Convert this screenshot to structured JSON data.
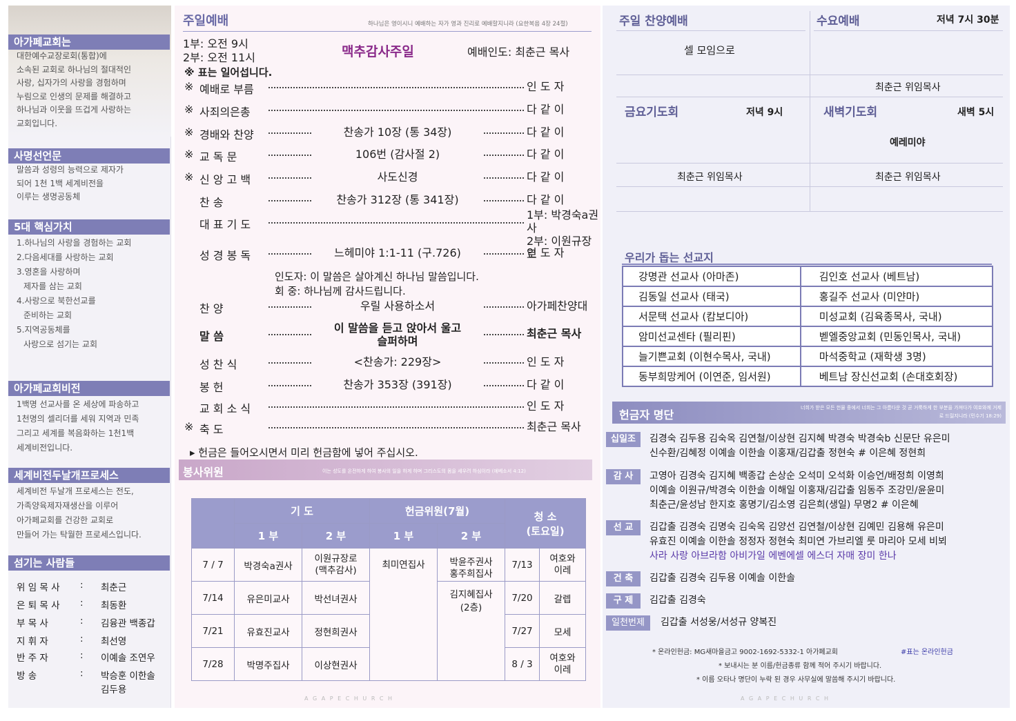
{
  "left": {
    "agape_title": "아가페교회는",
    "agape_body": [
      "대한예수교장로회(통합)에",
      "소속된 교회로 하나님의 절대적인",
      "사랑, 십자가의 사랑을 경험하며",
      "누림으로 인생의 문제를 해결하고",
      "하나님과 이웃을 뜨겁게 사랑하는",
      "교회입니다."
    ],
    "mission_title": "사명선언문",
    "mission_body": [
      "말씀과 성령의 능력으로 제자가",
      "되어 1천 1백 세계비전을",
      "이루는 생명공동체"
    ],
    "core_title": "5대 핵심가치",
    "core_body": [
      "1.하나님의 사랑을 경험하는 교회",
      "2.다음세대를 사랑하는 교회",
      "3.영혼을 사랑하며",
      "  제자를 삼는 교회",
      "4.사랑으로 북한선교를",
      "  준비하는 교회",
      "5.지역공동체를",
      "  사랑으로 섬기는 교회"
    ],
    "vision_title": "아가페교회비전",
    "vision_body": [
      "1백명 선교사를 온 세상에 파송하고",
      "1천명의 셀리더를 세워 지역과 민족",
      "그리고 세계를 복음화하는 1천1백",
      "세계비전입니다."
    ],
    "process_title": "세계비전두날개프로세스",
    "process_body": [
      "세계비전 두날개 프로세스는 전도,",
      "가족양육제자재생산을 이루어",
      "아가페교회를 건강한 교회로",
      "만들어 가는 탁월한 프로세스입니다."
    ],
    "staff_title": "섬기는 사람들",
    "staff": [
      {
        "role": "위 임 목 사",
        "sep": ":",
        "name": "최춘근"
      },
      {
        "role": "은 퇴 목 사",
        "sep": ":",
        "name": "최동환"
      },
      {
        "role": "부   목   사",
        "sep": ":",
        "name": "김융관 백종갑"
      },
      {
        "role": "지   휘   자",
        "sep": ":",
        "name": "최선영"
      },
      {
        "role": "반   주   자",
        "sep": ":",
        "name": "이예솔 조연우"
      },
      {
        "role": "방         송",
        "sep": ":",
        "name": "박승훈 이한솔"
      },
      {
        "role": "",
        "sep": "",
        "name": "김두용"
      }
    ]
  },
  "worship": {
    "title": "주일예배",
    "verse": "하나님은 영이시니 예배하는 자가 영과 진리로 예배할지니라 (요한복음 4장 24절)",
    "time1": "1부: 오전  9시",
    "time2": "2부: 오전 11시",
    "theme": "맥추감사주일",
    "leader": "예배인도: 최춘근 목사",
    "stand_note": "※ 표는 일어섭니다.",
    "items": [
      {
        "mark": "※",
        "name": "예배로 부름",
        "center": "",
        "right": "인   도   자"
      },
      {
        "mark": "※",
        "name": "사죄의은총",
        "center": "",
        "right": "다   같   이"
      },
      {
        "mark": "※",
        "name": "경배와 찬양",
        "center": "찬송가 10장 (통 34장)",
        "right": "다   같   이"
      },
      {
        "mark": "※",
        "name": "교   독   문",
        "center": "106번 (감사절 2)",
        "right": "다   같   이"
      },
      {
        "mark": "※",
        "name": "신 앙 고 백",
        "center": "사도신경",
        "right": "다   같   이"
      },
      {
        "mark": "",
        "name": "찬         송",
        "center": "찬송가 312장 (통 341장)",
        "right": "다   같   이"
      },
      {
        "mark": "",
        "name": "대 표 기 도",
        "center": "",
        "right": "1부: 박경숙a권사\n2부: 이원규장로"
      },
      {
        "mark": "",
        "name": "성 경 봉 독",
        "center": "느헤미야 1:1-11 (구.726)",
        "right": "인   도   자"
      },
      {
        "mark": "",
        "name": "찬         양",
        "center": "우릴 사용하소서",
        "right": "아가페찬양대"
      },
      {
        "mark": "",
        "name": "말         씀",
        "center": "이 말씀을 듣고 앉아서 울고\n슬퍼하며",
        "right": "최춘근 목사"
      },
      {
        "mark": "",
        "name": "성   찬   식",
        "center": "<찬송가: 229장>",
        "right": "인   도   자"
      },
      {
        "mark": "",
        "name": "봉         헌",
        "center": "찬송가 353장 (391장)",
        "right": "다   같   이"
      },
      {
        "mark": "",
        "name": "교 회 소 식",
        "center": "",
        "right": "인   도   자"
      },
      {
        "mark": "※",
        "name": "축         도",
        "center": "",
        "right": "최춘근 목사"
      }
    ],
    "response_leader": "인도자:  이 말씀은 살아계신 하나님 말씀입니다.",
    "response_people": "회   중:  하나님께 감사드립니다.",
    "offering_note": "▸    헌금은 들어오시면서 미리 헌금함에 넣어 주십시오."
  },
  "servants": {
    "title": "봉사위원",
    "verse": "이는 성도를 온전하게 하여 봉사의 일을 하게 하며 그리스도의 몸을 세우려 하심이라 (에베소서 4:12)",
    "h_prayer": "기   도",
    "h_offering": "헌금위원(7월)",
    "h_clean": "청 소\n(토요일)",
    "h_p1": "1 부",
    "h_p2": "2 부",
    "h_o1": "1 부",
    "h_o2": "2 부",
    "rows": [
      {
        "date": "7 / 7",
        "p1": "박경숙a권사",
        "p2": "이원규장로\n(맥추감사)",
        "cdate": "7/13",
        "clean": "여호와\n이레"
      },
      {
        "date": "7/14",
        "p1": "유은미교사",
        "p2": "박선녀권사",
        "cdate": "7/20",
        "clean": "갈렙"
      },
      {
        "date": "7/21",
        "p1": "유효진교사",
        "p2": "정현희권사",
        "cdate": "7/27",
        "clean": "모세"
      },
      {
        "date": "7/28",
        "p1": "박명주집사",
        "p2": "이상현권사",
        "cdate": "8 / 3",
        "clean": "여호와\n이레"
      }
    ],
    "o1": "최미연집사",
    "o2a": "박윤주권사\n홍주희집사",
    "o2b": "김지혜집사\n(2층)",
    "footer": "A  G  A  P  E     C  H  U  R  C  H"
  },
  "right": {
    "sunday_praise": "주일 찬양예배",
    "cell_meeting": "셀 모임으로",
    "wed_title": "수요예배",
    "wed_time": "저녁  7시  30분",
    "wed_leader": "최춘근 위임목사",
    "fri_title": "금요기도회",
    "fri_time": "저녁  9시",
    "fri_leader": "최춘근 위임목사",
    "dawn_title": "새벽기도회",
    "dawn_time": "새벽  5시",
    "dawn_text": "예레미야",
    "dawn_leader": "최춘근 위임목사",
    "missions_title": "우리가 돕는 선교지",
    "missions": [
      [
        "강명관 선교사 (아마존)",
        "김인호 선교사 (베트남)"
      ],
      [
        "김동일 선교사 (태국)",
        "홍길주 선교사 (미얀마)"
      ],
      [
        "서문택 선교사 (캄보디아)",
        "미성교회 (김육종목사, 국내)"
      ],
      [
        "암미선교센타 (필리핀)",
        "벧엘중앙교회 (민동인목사, 국내)"
      ],
      [
        "늘기쁜교회 (이현수목사, 국내)",
        "마석중학교 (재학생 3명)"
      ],
      [
        "동부희망케어 (이연준, 임서원)",
        "베트남 장신선교회 (손대호회장)"
      ]
    ],
    "donors_title": "헌금자 명단",
    "donors_verse": "너희가 받은 모든 헌물 중에서 너희는 그 아름다운 것 곧 거룩하게 한 부분을 가져다가 여호와께 거제로 드릴지니라 (민수기 18:29)",
    "groups": [
      {
        "label": "십일조",
        "lines": [
          "김경숙 김두용 김숙옥 김연철/이상현 김지혜 박경숙 박경숙b 신문단 유은미",
          "신수환/김혜정 이예솔 이한솔 이홍재/김갑출 정현숙    #  이은혜 정현희"
        ]
      },
      {
        "label": "감 사",
        "lines": [
          "고영아 김경숙 김지혜 백종갑 손상순 오석미 오석화 이승언/배정희 이영희",
          "이예솔 이원규/박경숙 이한솔 이해일 이홍재/김갑출 임동주 조강민/윤윤미",
          "최춘근/윤성남 한지호 홍명기/김소영 김은희(생일) 무명2          #  이은혜"
        ]
      },
      {
        "label": "선 교",
        "lines": [
          "김갑출 김경숙 김명숙 김숙옥 김양선 김연철/이상현 김예민 김용해 유은미",
          "유효진 이예솔 이한솔 정정자 정현숙 최미연 가브리엘 룻 마리아 모세 비뵈",
          "사라 사랑 아브라함 아비가일 에벤에셀 에스더 자매 장미 한나"
        ]
      },
      {
        "label": "건 축",
        "lines": [
          "김갑출 김경숙 김두용 이예솔 이한솔"
        ]
      },
      {
        "label": "구 제",
        "lines": [
          "김갑출 김경숙"
        ]
      },
      {
        "label": "일천번제",
        "lines": [
          "김갑출 서성웅/서성규 양복진"
        ]
      }
    ],
    "note1": "* 온라인헌금: MG새마을금고 9002-1692-5332-1 아가페교회",
    "note1b": "#표는 온라인헌금",
    "note2": "* 보내시는 분 이름/헌금종류 함께 적어 주시기 바랍니다.",
    "note3": "* 이름 오타나 명단이 누락 된 경우 사무실에 말씀해 주시기 바랍니다.",
    "footer": "A  G  A  P  E     C  H  U  R  C  H"
  }
}
